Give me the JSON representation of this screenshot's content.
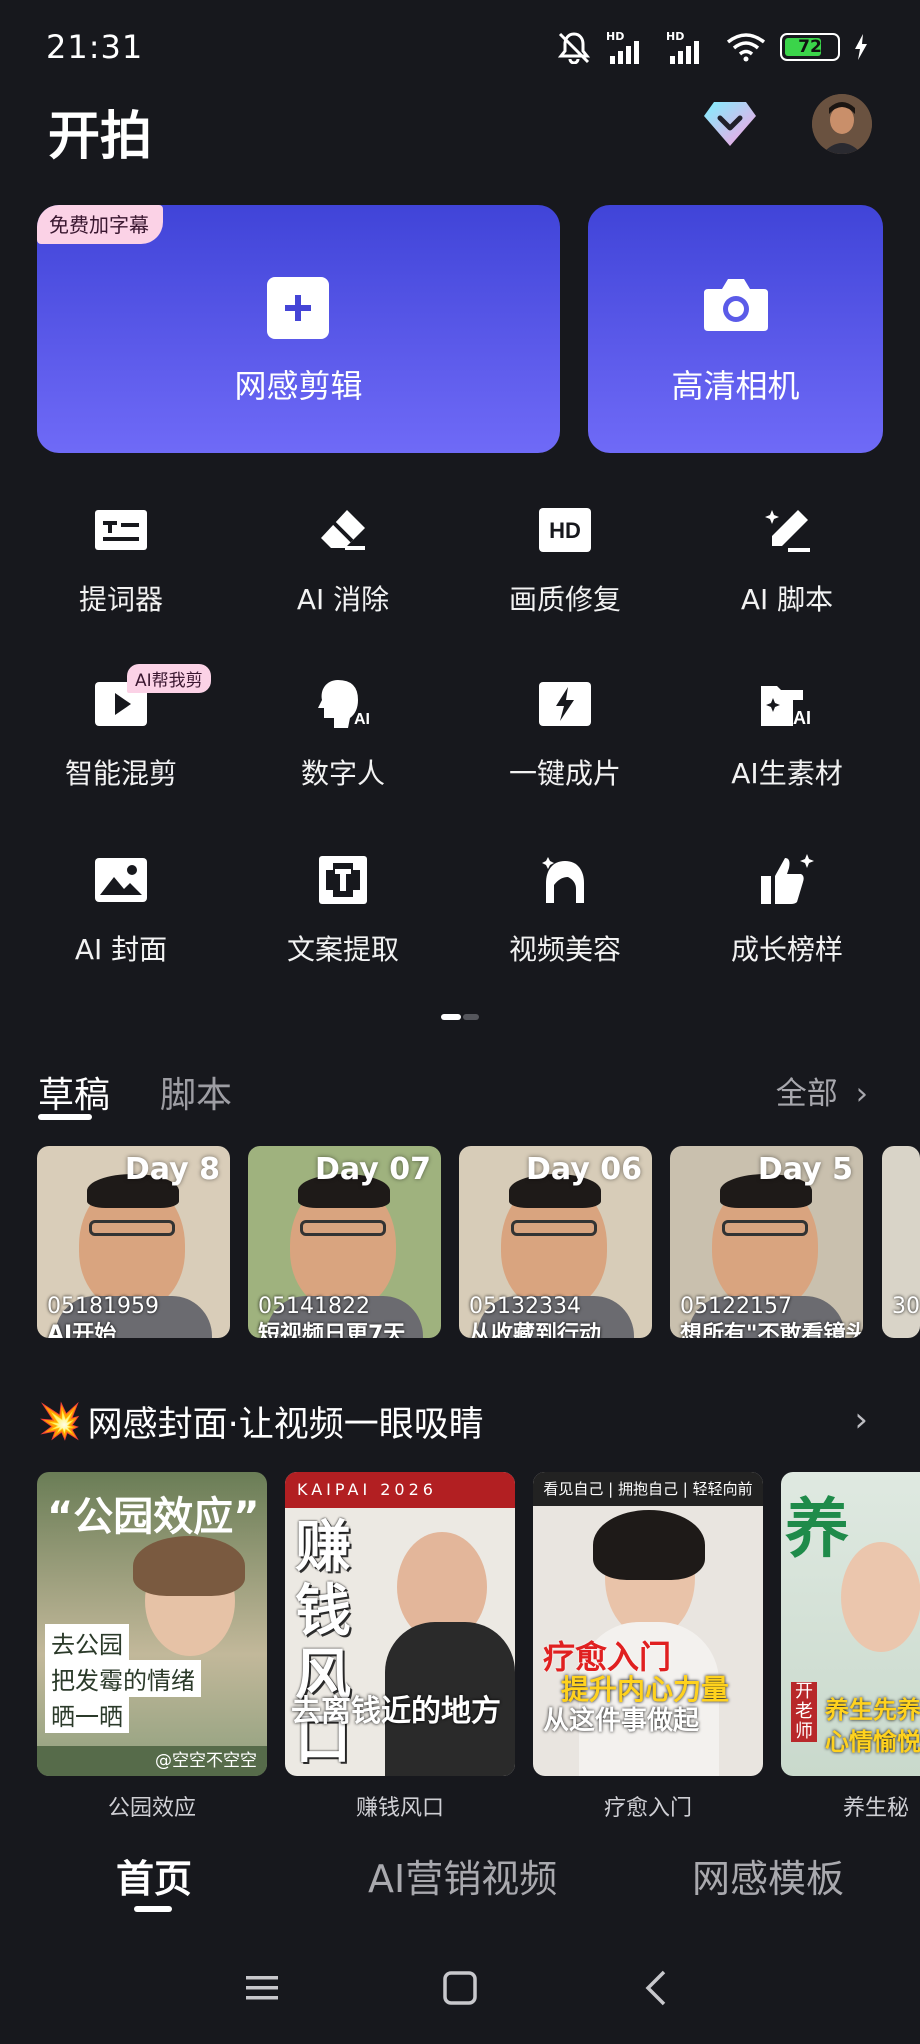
{
  "status": {
    "time": "21:31",
    "battery": "72",
    "battery_level": 0.72,
    "signal1_label": "HD",
    "signal2_label": "HD"
  },
  "header": {
    "title": "开拍"
  },
  "cards": {
    "edit": {
      "badge": "免费加字幕",
      "label": "网感剪辑"
    },
    "camera": {
      "label": "高清相机"
    }
  },
  "tools": [
    {
      "label": "提词器",
      "icon": "teleprompter-icon"
    },
    {
      "label": "AI 消除",
      "icon": "eraser-icon"
    },
    {
      "label": "画质修复",
      "icon": "hd-icon"
    },
    {
      "label": "AI 脚本",
      "icon": "magic-pen-icon"
    },
    {
      "label": "智能混剪",
      "icon": "play-icon",
      "badge": "AI帮我剪"
    },
    {
      "label": "数字人",
      "icon": "ai-avatar-icon"
    },
    {
      "label": "一键成片",
      "icon": "lightning-icon"
    },
    {
      "label": "AI生素材",
      "icon": "ai-folder-icon"
    },
    {
      "label": "AI 封面",
      "icon": "image-icon"
    },
    {
      "label": "文案提取",
      "icon": "text-scan-icon"
    },
    {
      "label": "视频美容",
      "icon": "face-beauty-icon"
    },
    {
      "label": "成长榜样",
      "icon": "thumbs-up-icon"
    }
  ],
  "drafts_section": {
    "tab_drafts": "草稿",
    "tab_scripts": "脚本",
    "see_all": "全部"
  },
  "drafts": [
    {
      "day": "Day 8",
      "code": "05181959",
      "caption": "AI开始"
    },
    {
      "day": "Day 07",
      "code": "05141822",
      "caption": "短视频日更7天"
    },
    {
      "day": "Day 06",
      "code": "05132334",
      "caption": "从收藏到行动"
    },
    {
      "day": "Day 5",
      "code": "05122157",
      "caption": "想所有\"不敢看镜头\""
    },
    {
      "day": "",
      "code": "30",
      "caption": ""
    }
  ],
  "promo": {
    "emoji": "💥",
    "title": "网感封面·让视频一眼吸睛"
  },
  "covers": [
    {
      "caption": "公园效应",
      "headline": "“公园效应”",
      "line1": "去公园",
      "line2": "把发霉的情绪",
      "line3": "晒一晒",
      "handle": "@空空不空空"
    },
    {
      "caption": "赚钱风口",
      "brand": "KAIPAI 2026",
      "headline": "赚钱风口",
      "line1": "去离钱近的地方"
    },
    {
      "caption": "疗愈入门",
      "top": "看见自己 | 拥抱自己 | 轻轻向前",
      "line1": "疗愈入门",
      "line2": "提升内心力量",
      "line3": "从这件事做起"
    },
    {
      "caption": "养生秘",
      "line1": "养生先养",
      "line2": "心情愉悦",
      "tag": "开老师"
    }
  ],
  "bottom_nav": {
    "home": "首页",
    "ai_marketing": "AI营销视频",
    "templates": "网感模板"
  }
}
